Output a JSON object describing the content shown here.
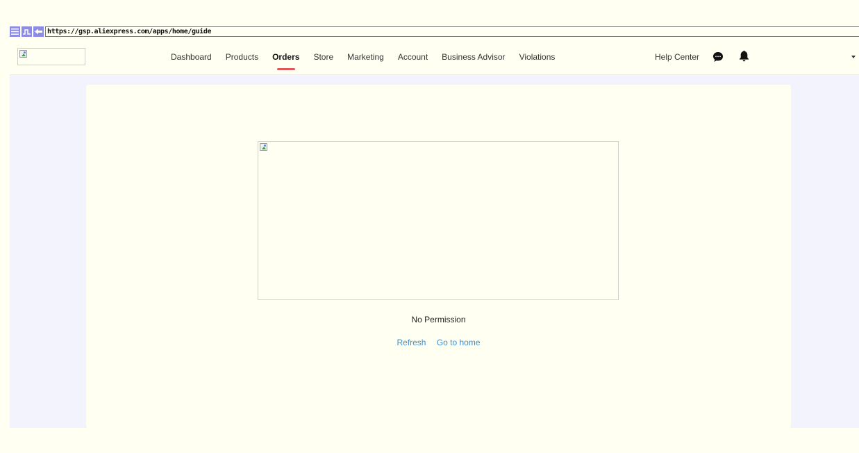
{
  "browser": {
    "url": "https://gsp.aliexpress.com/apps/home/guide"
  },
  "header": {
    "nav": [
      {
        "label": "Dashboard"
      },
      {
        "label": "Products"
      },
      {
        "label": "Orders",
        "active": true
      },
      {
        "label": "Store"
      },
      {
        "label": "Marketing"
      },
      {
        "label": "Account"
      },
      {
        "label": "Business Advisor"
      },
      {
        "label": "Violations"
      }
    ],
    "help_center": "Help Center",
    "icons": [
      "message-icon",
      "bell-icon",
      "caret-down-icon"
    ]
  },
  "main": {
    "message": "No Permission",
    "refresh_label": "Refresh",
    "home_label": "Go to home"
  },
  "colors": {
    "accent": "#e2575c",
    "link": "#3b8fd0",
    "toolbar_button": "#8c8ce6",
    "page_bg": "#f3f3fd"
  }
}
